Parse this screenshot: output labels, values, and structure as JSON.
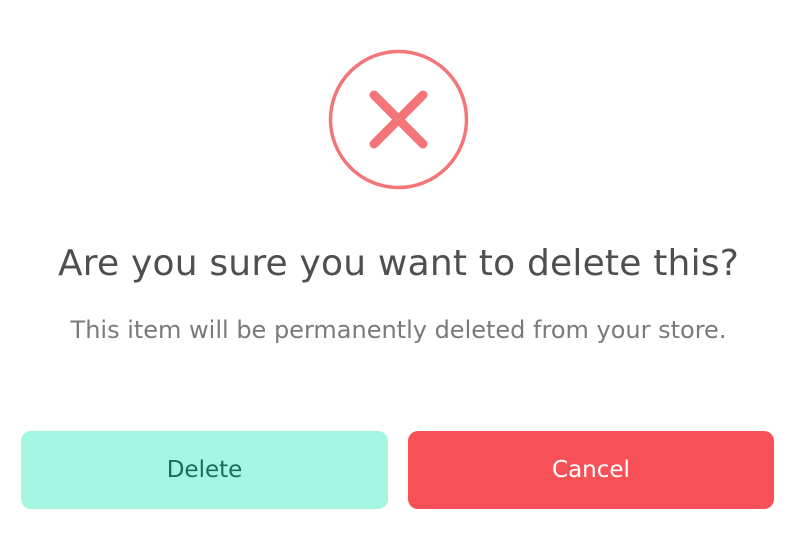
{
  "dialog": {
    "icon": "close-x-circle-icon",
    "icon_color": "#f37578",
    "title": "Are you sure you want to delete this?",
    "message": "This item will be permanently deleted from your store.",
    "buttons": {
      "delete_label": "Delete",
      "cancel_label": "Cancel"
    },
    "colors": {
      "delete_bg": "#a3f7e1",
      "delete_text": "#1d6b5b",
      "cancel_bg": "#f75157",
      "cancel_text": "#ffffff"
    }
  }
}
